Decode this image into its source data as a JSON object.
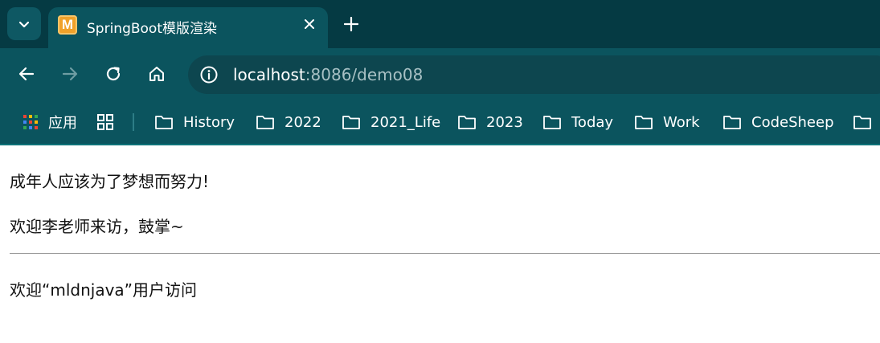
{
  "browser": {
    "tab": {
      "favicon_letter": "M",
      "title": "SpringBoot模版渲染"
    },
    "address": {
      "host": "localhost",
      "rest": ":8086/demo08"
    },
    "bookmarks": [
      {
        "label": "应用",
        "icon": "apps-grid-icon"
      },
      {
        "label": "",
        "icon": "tab-groups-icon"
      },
      {
        "label": "History",
        "icon": "folder-icon"
      },
      {
        "label": "2022",
        "icon": "folder-icon"
      },
      {
        "label": "2021_Life",
        "icon": "folder-icon"
      },
      {
        "label": "2023",
        "icon": "folder-icon"
      },
      {
        "label": "Today",
        "icon": "folder-icon"
      },
      {
        "label": "Work",
        "icon": "folder-icon"
      },
      {
        "label": "CodeSheep",
        "icon": "folder-icon"
      },
      {
        "label": "",
        "icon": "folder-icon"
      }
    ],
    "colors": {
      "tabstrip": "#053a43",
      "toolbar": "#0b545e",
      "omnibox": "#0d464f",
      "text": "#ffffff"
    }
  },
  "page": {
    "line1": "成年人应该为了梦想而努力!",
    "line2": "欢迎李老师来访，鼓掌~",
    "line3": "欢迎“mldnjava”用户访问"
  }
}
